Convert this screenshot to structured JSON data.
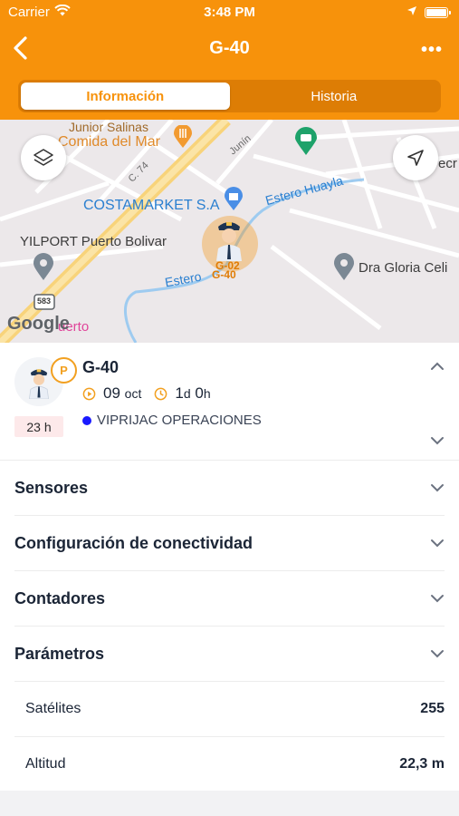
{
  "status_bar": {
    "carrier": "Carrier",
    "time": "3:48 PM"
  },
  "navbar": {
    "title": "G-40",
    "more": "•••"
  },
  "tabs": [
    {
      "label": "Información",
      "active": true
    },
    {
      "label": "Historia",
      "active": false
    }
  ],
  "map": {
    "labels": {
      "junior": "Junior Salinas",
      "comida": "Comida del Mar",
      "costamarket": "COSTAMARKET S.A",
      "yilport": "YILPORT Puerto Bolivar",
      "estero_huayla": "Estero Huayla",
      "estero_bottom": "Estero",
      "dra_gloria": "Dra Gloria Celi",
      "c74": "C. 74",
      "junin": "Junín",
      "route": "583",
      "puerto": "uerto",
      "ecr": "ecr",
      "marker_a": "G-02",
      "marker_b": "G-40"
    },
    "brand": "Google"
  },
  "unit": {
    "name": "G-40",
    "badge": "P",
    "elapsed": "23 h",
    "date_day": "09",
    "date_month": "oct",
    "duration_days": "1",
    "duration_days_unit": "d",
    "duration_hours": "0",
    "duration_hours_unit": "h",
    "group": "VIPRIJAC OPERACIONES"
  },
  "sections": [
    {
      "label": "Sensores"
    },
    {
      "label": "Configuración de conectividad"
    },
    {
      "label": "Contadores"
    },
    {
      "label": "Parámetros"
    }
  ],
  "parameters": [
    {
      "key": "Satélites",
      "value": "255"
    },
    {
      "key": "Altitud",
      "value": "22,3 m"
    }
  ],
  "colors": {
    "brand_orange": "#f7920b",
    "group_dot": "#1a1aff"
  }
}
